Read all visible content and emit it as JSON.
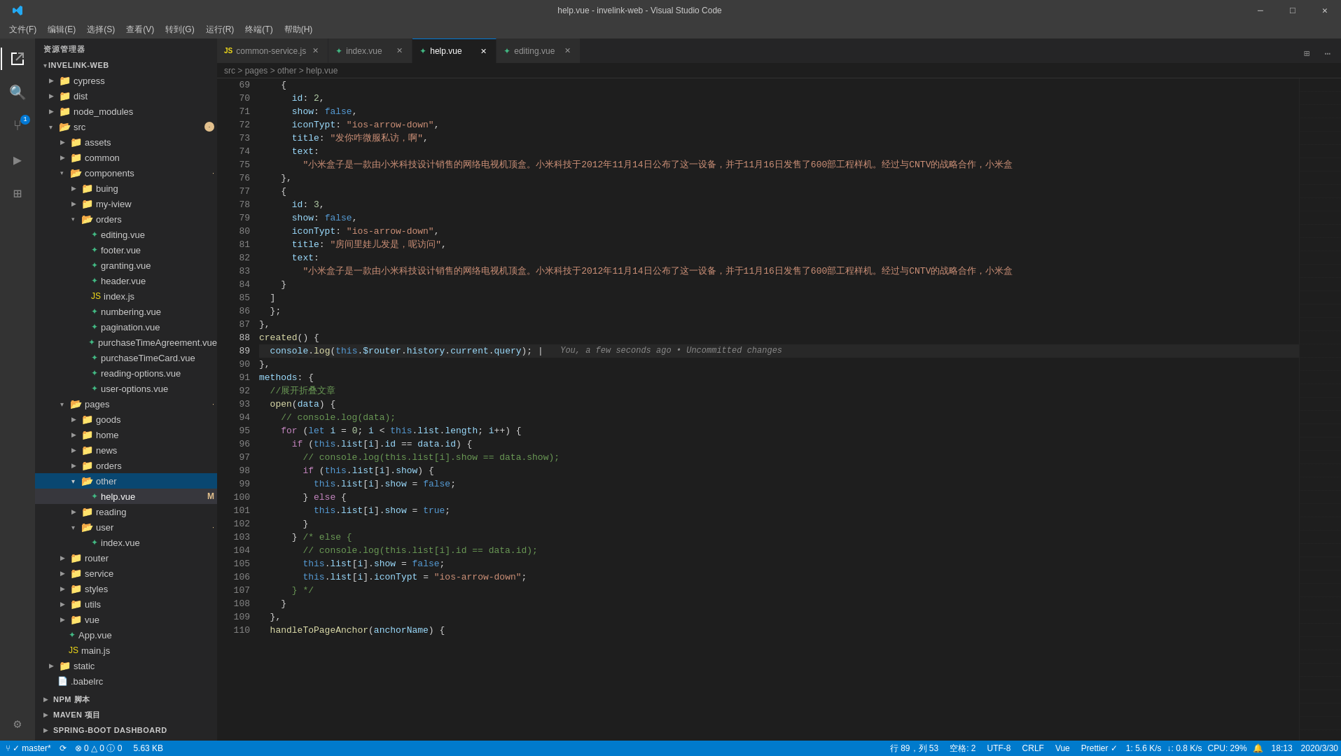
{
  "titleBar": {
    "title": "help.vue - invelink-web - Visual Studio Code",
    "controls": [
      "─",
      "□",
      "✕"
    ]
  },
  "menuBar": {
    "items": [
      "文件(F)",
      "编辑(E)",
      "选择(S)",
      "查看(V)",
      "转到(G)",
      "运行(R)",
      "终端(T)",
      "帮助(H)"
    ]
  },
  "tabs": [
    {
      "label": "common-service.js",
      "icon": "js",
      "active": false,
      "modified": false,
      "color": "#f5de19"
    },
    {
      "label": "index.vue",
      "icon": "vue",
      "active": false,
      "modified": false,
      "color": "#42b883"
    },
    {
      "label": "help.vue",
      "icon": "vue",
      "active": true,
      "modified": true,
      "color": "#42b883"
    },
    {
      "label": "editing.vue",
      "icon": "vue",
      "active": false,
      "modified": false,
      "color": "#42b883"
    }
  ],
  "sidebar": {
    "title": "资源管理器",
    "root": "INVELINK-WEB",
    "tree": [
      {
        "label": "cypress",
        "type": "folder",
        "indent": 1,
        "open": false
      },
      {
        "label": "dist",
        "type": "folder",
        "indent": 1,
        "open": false
      },
      {
        "label": "node_modules",
        "type": "folder",
        "indent": 1,
        "open": false
      },
      {
        "label": "src",
        "type": "folder",
        "indent": 1,
        "open": true,
        "badge": true
      },
      {
        "label": "assets",
        "type": "folder",
        "indent": 2,
        "open": false
      },
      {
        "label": "common",
        "type": "folder",
        "indent": 2,
        "open": false
      },
      {
        "label": "components",
        "type": "folder",
        "indent": 2,
        "open": false,
        "badge": true
      },
      {
        "label": "buing",
        "type": "folder",
        "indent": 3,
        "open": false
      },
      {
        "label": "my-iview",
        "type": "folder",
        "indent": 3,
        "open": false
      },
      {
        "label": "orders",
        "type": "folder",
        "indent": 3,
        "open": false
      },
      {
        "label": "editing.vue",
        "type": "vue",
        "indent": 4
      },
      {
        "label": "footer.vue",
        "type": "vue",
        "indent": 4
      },
      {
        "label": "granting.vue",
        "type": "vue",
        "indent": 4
      },
      {
        "label": "header.vue",
        "type": "vue",
        "indent": 4
      },
      {
        "label": "index.js",
        "type": "js",
        "indent": 4
      },
      {
        "label": "numbering.vue",
        "type": "vue",
        "indent": 4
      },
      {
        "label": "pagination.vue",
        "type": "vue",
        "indent": 4
      },
      {
        "label": "purchaseTimeAgreement.vue",
        "type": "vue",
        "indent": 4
      },
      {
        "label": "purchaseTimeCard.vue",
        "type": "vue",
        "indent": 4
      },
      {
        "label": "reading-options.vue",
        "type": "vue",
        "indent": 4
      },
      {
        "label": "user-options.vue",
        "type": "vue",
        "indent": 4
      },
      {
        "label": "pages",
        "type": "folder",
        "indent": 2,
        "open": true,
        "badge": true
      },
      {
        "label": "goods",
        "type": "folder",
        "indent": 3,
        "open": false
      },
      {
        "label": "home",
        "type": "folder",
        "indent": 3,
        "open": false
      },
      {
        "label": "news",
        "type": "folder",
        "indent": 3,
        "open": false
      },
      {
        "label": "orders",
        "type": "folder",
        "indent": 3,
        "open": false
      },
      {
        "label": "other",
        "type": "folder",
        "indent": 3,
        "open": true,
        "badge": true
      },
      {
        "label": "help.vue",
        "type": "vue",
        "indent": 4,
        "active": true,
        "modified": true
      },
      {
        "label": "reading",
        "type": "folder",
        "indent": 3,
        "open": false
      },
      {
        "label": "user",
        "type": "folder",
        "indent": 3,
        "open": true,
        "badge": true
      },
      {
        "label": "index.vue",
        "type": "vue",
        "indent": 4
      },
      {
        "label": "router",
        "type": "folder",
        "indent": 2,
        "open": false
      },
      {
        "label": "service",
        "type": "folder",
        "indent": 2,
        "open": false
      },
      {
        "label": "styles",
        "type": "folder",
        "indent": 2,
        "open": false
      },
      {
        "label": "utils",
        "type": "folder",
        "indent": 2,
        "open": false
      },
      {
        "label": "vue",
        "type": "folder",
        "indent": 2,
        "open": false
      },
      {
        "label": "App.vue",
        "type": "vue",
        "indent": 2
      },
      {
        "label": "main.js",
        "type": "js",
        "indent": 2
      },
      {
        "label": "static",
        "type": "folder",
        "indent": 1,
        "open": false
      },
      {
        "label": "babelrc",
        "type": "file",
        "indent": 1
      },
      {
        "label": "NPM 脚本",
        "type": "section",
        "indent": 0
      },
      {
        "label": "MAVEN 项目",
        "type": "section",
        "indent": 0
      },
      {
        "label": "SPRING-BOOT DASHBOARD",
        "type": "section",
        "indent": 0
      }
    ]
  },
  "code": {
    "startLine": 69,
    "lines": [
      {
        "num": 69,
        "content": "    {"
      },
      {
        "num": 70,
        "content": "      id: 2,"
      },
      {
        "num": 71,
        "content": "      show: false,"
      },
      {
        "num": 72,
        "content": "      iconTypt: \"ios-arrow-down\","
      },
      {
        "num": 73,
        "content": "      title: \"发你咋微服私访，啊\","
      },
      {
        "num": 74,
        "content": "      text:"
      },
      {
        "num": 75,
        "content": "        \"小米盒子是一款由小米科技设计销售的网络电视机顶盒。小米科技于2012年11月14日公布了这一设备，并于11月16日发售了600部工程样机。经过与CNTV的战略合作，小米盒"
      },
      {
        "num": 76,
        "content": "    },"
      },
      {
        "num": 77,
        "content": "    {"
      },
      {
        "num": 78,
        "content": "      id: 3,"
      },
      {
        "num": 79,
        "content": "      show: false,"
      },
      {
        "num": 80,
        "content": "      iconTypt: \"ios-arrow-down\","
      },
      {
        "num": 81,
        "content": "      title: \"房间里娃儿发是，呢访问\","
      },
      {
        "num": 82,
        "content": "      text:"
      },
      {
        "num": 83,
        "content": "        \"小米盒子是一款由小米科技设计销售的网络电视机顶盒。小米科技于2012年11月14日公布了这一设备，并于11月16日发售了600部工程样机。经过与CNTV的战略合作，小米盒"
      },
      {
        "num": 84,
        "content": "    }"
      },
      {
        "num": 85,
        "content": "  ]"
      },
      {
        "num": 86,
        "content": "  };"
      },
      {
        "num": 87,
        "content": "},"
      },
      {
        "num": 88,
        "content": "created() {"
      },
      {
        "num": 89,
        "content": "  console.log(this.$router.history.current.query);",
        "active": true,
        "hint": "  You, a few seconds ago • Uncommitted changes"
      },
      {
        "num": 90,
        "content": "},"
      },
      {
        "num": 91,
        "content": "methods: {"
      },
      {
        "num": 92,
        "content": "  //展开折叠文章"
      },
      {
        "num": 93,
        "content": "  open(data) {"
      },
      {
        "num": 94,
        "content": "    // console.log(data);"
      },
      {
        "num": 95,
        "content": "    for (let i = 0; i < this.list.length; i++) {"
      },
      {
        "num": 96,
        "content": "      if (this.list[i].id == data.id) {"
      },
      {
        "num": 97,
        "content": "        // console.log(this.list[i].show == data.show);"
      },
      {
        "num": 98,
        "content": "        if (this.list[i].show) {"
      },
      {
        "num": 99,
        "content": "          this.list[i].show = false;"
      },
      {
        "num": 100,
        "content": "        } else {"
      },
      {
        "num": 101,
        "content": "          this.list[i].show = true;"
      },
      {
        "num": 102,
        "content": "        }"
      },
      {
        "num": 103,
        "content": "      } /* else {"
      },
      {
        "num": 104,
        "content": "        // console.log(this.list[i].id == data.id);"
      },
      {
        "num": 105,
        "content": "        this.list[i].show = false;"
      },
      {
        "num": 106,
        "content": "        this.list[i].iconTypt = \"ios-arrow-down\";"
      },
      {
        "num": 107,
        "content": "      } */"
      },
      {
        "num": 108,
        "content": "    }"
      },
      {
        "num": 109,
        "content": "  },"
      },
      {
        "num": 110,
        "content": "  handleToPageAnchor(anchorName) {"
      }
    ]
  },
  "statusBar": {
    "git": "✓ master*",
    "sync": "⟳",
    "errors": "⊗ 0 △ 0 ⓘ 0",
    "fileSize": "5.63 KB",
    "position": "行 89，列 53",
    "spaces": "空格: 2",
    "encoding": "UTF-8",
    "lineEnding": "CRLF",
    "language": "Vue",
    "prettier": "Prettier ✓",
    "right1": "1: 5.6 K/s",
    "right2": "↓: 0.8 K/s",
    "cpu": "CPU: 29%",
    "time": "18:13",
    "date": "2020/3/30"
  }
}
